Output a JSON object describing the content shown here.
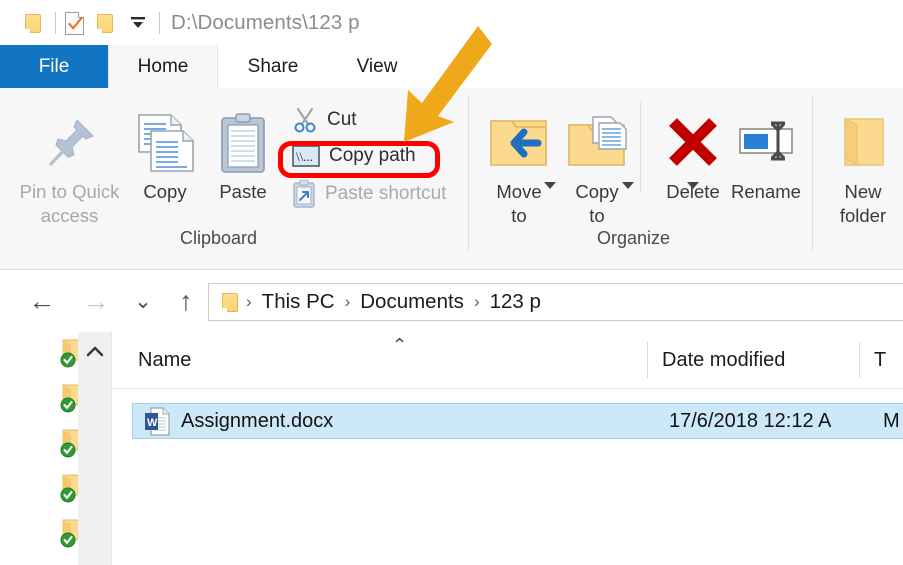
{
  "window": {
    "path_text": "D:\\Documents\\123 p",
    "quick_access": [
      {
        "name": "explorer-folder-icon",
        "label": "File Explorer"
      },
      {
        "name": "properties-checklist-icon",
        "label": "Properties"
      },
      {
        "name": "new-folder-quick-icon",
        "label": "New folder"
      },
      {
        "name": "customize-quick-access-caret",
        "label": "Customize Quick Access Toolbar"
      }
    ]
  },
  "tabs": [
    {
      "id": "file",
      "label": "File",
      "active": false
    },
    {
      "id": "home",
      "label": "Home",
      "active": true
    },
    {
      "id": "share",
      "label": "Share",
      "active": false
    },
    {
      "id": "view",
      "label": "View",
      "active": false
    }
  ],
  "ribbon": {
    "groups": [
      {
        "id": "clipboard",
        "label": "Clipboard"
      },
      {
        "id": "organize",
        "label": "Organize"
      }
    ],
    "clipboard": {
      "pin_label": "Pin to Quick\naccess",
      "copy_label": "Copy",
      "paste_label": "Paste",
      "cut_label": "Cut",
      "copy_path_label": "Copy path",
      "paste_shortcut_label": "Paste shortcut"
    },
    "organize": {
      "move_to_label": "Move\nto",
      "copy_to_label": "Copy\nto",
      "delete_label": "Delete",
      "rename_label": "Rename"
    },
    "new": {
      "new_folder_label": "New\nfolder"
    }
  },
  "annotations": {
    "highlight_target": "Copy path",
    "highlight_color": "#ff0000",
    "arrow_color": "#f0a81b"
  },
  "navigation": {
    "back_label": "Back",
    "forward_label": "Forward",
    "recent_label": "Recent locations",
    "up_label": "Up",
    "breadcrumbs": [
      "This PC",
      "Documents",
      "123 p"
    ],
    "separator": "›"
  },
  "filelist": {
    "columns": [
      {
        "id": "name",
        "label": "Name",
        "sorted": true
      },
      {
        "id": "date_modified",
        "label": "Date modified",
        "sorted": false
      },
      {
        "id": "type",
        "label": "T",
        "sorted": false
      }
    ],
    "sort_indicator": "⌃",
    "rows": [
      {
        "icon": "word-document-icon",
        "name": "Assignment.docx",
        "date_modified": "17/6/2018 12:12 A",
        "type": "M",
        "selected": true
      }
    ]
  },
  "nav_pane": {
    "scroll_up_glyph": "⌃",
    "items": [
      {
        "name": "synced-folder-icon"
      },
      {
        "name": "synced-folder-icon"
      },
      {
        "name": "synced-folder-icon"
      },
      {
        "name": "synced-folder-icon"
      },
      {
        "name": "synced-folder-icon"
      }
    ]
  },
  "colors": {
    "accent": "#1175c4",
    "selection": "#cde8f7",
    "ribbon_bg": "#f7f7f7",
    "folder_yellow": "#fbd374"
  }
}
